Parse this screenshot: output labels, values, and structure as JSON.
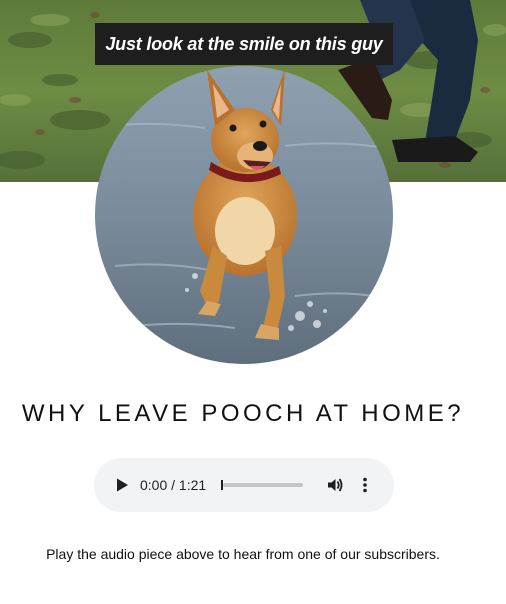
{
  "hero": {
    "caption": "Just look at the smile on this guy",
    "image_subject": "dog running through shallow water"
  },
  "heading": "WHY LEAVE POOCH AT HOME?",
  "audio_player": {
    "time_display": "0:00 / 1:21",
    "progress_fraction": 0,
    "play_icon": "play-icon",
    "volume_icon": "volume-icon",
    "more_icon": "more-options-icon"
  },
  "note": "Play the audio piece above to hear from one of our subscribers.",
  "colors": {
    "caption_bg": "#1e1e1e",
    "player_bg": "#f1f3f4",
    "text": "#111111"
  }
}
